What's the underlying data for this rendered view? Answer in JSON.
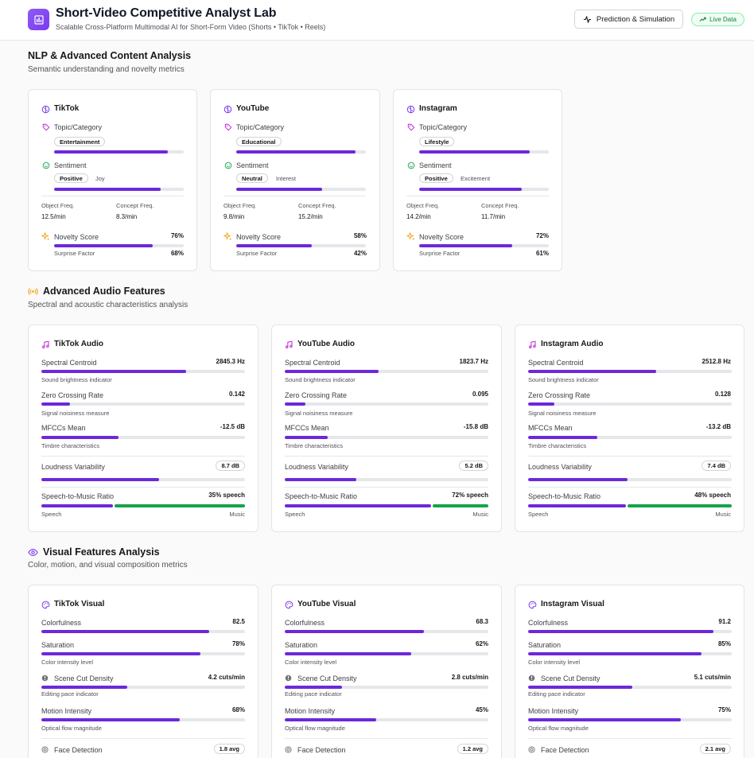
{
  "header": {
    "title": "Short-Video Competitive Analyst Lab",
    "subtitle": "Scalable Cross-Platform Multimodal AI for Short-Form Video (Shorts • TikTok • Reels)",
    "prediction_button": "Prediction & Simulation",
    "live_badge": "Live Data"
  },
  "nlp": {
    "title": "NLP & Advanced Content Analysis",
    "subtitle": "Semantic understanding and novelty metrics",
    "topic_label": "Topic/Category",
    "sentiment_label": "Sentiment",
    "object_freq_label": "Object Freq.",
    "concept_freq_label": "Concept Freq.",
    "novelty_label": "Novelty Score",
    "surprise_label": "Surprise Factor",
    "cards": [
      {
        "platform": "TikTok",
        "topic": "Entertainment",
        "topic_level": 0.88,
        "sentiment": "Positive",
        "emotion": "Joy",
        "sentiment_level": 0.82,
        "object_freq": "12.5/min",
        "concept_freq": "8.3/min",
        "novelty": "76%",
        "novelty_level": 0.76,
        "surprise": "68%"
      },
      {
        "platform": "YouTube",
        "topic": "Educational",
        "topic_level": 0.92,
        "sentiment": "Neutral",
        "emotion": "Interest",
        "sentiment_level": 0.66,
        "object_freq": "9.8/min",
        "concept_freq": "15.2/min",
        "novelty": "58%",
        "novelty_level": 0.58,
        "surprise": "42%"
      },
      {
        "platform": "Instagram",
        "topic": "Lifestyle",
        "topic_level": 0.85,
        "sentiment": "Positive",
        "emotion": "Excitement",
        "sentiment_level": 0.79,
        "object_freq": "14.2/min",
        "concept_freq": "11.7/min",
        "novelty": "72%",
        "novelty_level": 0.72,
        "surprise": "61%"
      }
    ]
  },
  "audio": {
    "title": "Advanced Audio Features",
    "subtitle": "Spectral and acoustic characteristics analysis",
    "centroid_label": "Spectral Centroid",
    "centroid_hint": "Sound brightness indicator",
    "zcr_label": "Zero Crossing Rate",
    "zcr_hint": "Signal noisiness measure",
    "mfcc_label": "MFCCs Mean",
    "mfcc_hint": "Timbre characteristics",
    "loudness_label": "Loudness Variability",
    "ratio_label": "Speech-to-Music Ratio",
    "speech_label": "Speech",
    "music_label": "Music",
    "cards": [
      {
        "title": "TikTok Audio",
        "centroid": "2845.3 Hz",
        "centroid_level": 0.71,
        "zcr": "0.142",
        "zcr_level": 0.14,
        "mfcc": "-12.5 dB",
        "mfcc_level": 0.38,
        "loudness": "8.7 dB",
        "loudness_level": 0.58,
        "ratio": "35% speech",
        "speech_share": 0.35
      },
      {
        "title": "YouTube Audio",
        "centroid": "1823.7 Hz",
        "centroid_level": 0.46,
        "zcr": "0.095",
        "zcr_level": 0.1,
        "mfcc": "-15.8 dB",
        "mfcc_level": 0.21,
        "loudness": "5.2 dB",
        "loudness_level": 0.35,
        "ratio": "72% speech",
        "speech_share": 0.72
      },
      {
        "title": "Instagram Audio",
        "centroid": "2512.8 Hz",
        "centroid_level": 0.63,
        "zcr": "0.128",
        "zcr_level": 0.13,
        "mfcc": "-13.2 dB",
        "mfcc_level": 0.34,
        "loudness": "7.4 dB",
        "loudness_level": 0.49,
        "ratio": "48% speech",
        "speech_share": 0.48
      }
    ]
  },
  "visual": {
    "title": "Visual Features Analysis",
    "subtitle": "Color, motion, and visual composition metrics",
    "colorfulness_label": "Colorfulness",
    "saturation_label": "Saturation",
    "saturation_hint": "Color intensity level",
    "cut_label": "Scene Cut Density",
    "cut_hint": "Editing pace indicator",
    "motion_label": "Motion Intensity",
    "motion_hint": "Optical flow magnitude",
    "face_label": "Face Detection",
    "cards": [
      {
        "title": "TikTok Visual",
        "colorfulness": "82.5",
        "colorfulness_level": 0.825,
        "saturation": "78%",
        "saturation_level": 0.78,
        "cut": "4.2 cuts/min",
        "cut_level": 0.42,
        "motion": "68%",
        "motion_level": 0.68,
        "face": "1.8 avg"
      },
      {
        "title": "YouTube Visual",
        "colorfulness": "68.3",
        "colorfulness_level": 0.683,
        "saturation": "62%",
        "saturation_level": 0.62,
        "cut": "2.8 cuts/min",
        "cut_level": 0.28,
        "motion": "45%",
        "motion_level": 0.45,
        "face": "1.2 avg"
      },
      {
        "title": "Instagram Visual",
        "colorfulness": "91.2",
        "colorfulness_level": 0.912,
        "saturation": "85%",
        "saturation_level": 0.85,
        "cut": "5.1 cuts/min",
        "cut_level": 0.51,
        "motion": "75%",
        "motion_level": 0.75,
        "face": "2.1 avg"
      }
    ]
  },
  "colors": {
    "accent": "#6d28d9",
    "music": "#16a34a",
    "track": "#e5e7eb",
    "live": "#15803d"
  }
}
